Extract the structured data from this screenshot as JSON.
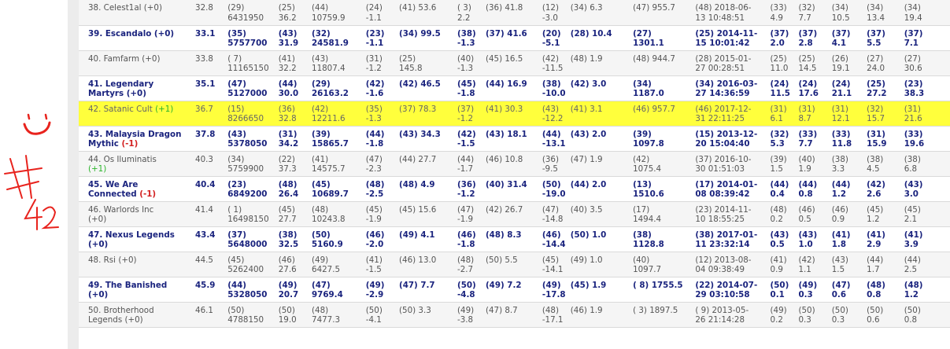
{
  "rows": [
    {
      "name": "38. Celest1al",
      "change": "(+0)",
      "change_type": "zero",
      "score": "32.8",
      "c1": "(29)\n6431950",
      "c2": "(25)\n36.2",
      "c3": "(44)\n10759.9",
      "c4": "(24)\n-1.1",
      "c5": "(41) 53.6",
      "c6": "( 3)\n2.2",
      "c7": "(36) 41.8",
      "c8": "(12)\n-3.0",
      "c9": "(34) 6.3",
      "c10": "(47) 955.7",
      "c11": "(48) 2018-06-\n13 10:48:51",
      "c12": "(33)\n4.9",
      "c13": "(32)\n7.7",
      "c14": "(34)\n10.5",
      "c15": "(34)\n13.4",
      "c16": "(34)\n19.4",
      "style": "alt"
    },
    {
      "name": "39. Escandalo",
      "change": "(+0)",
      "change_type": "zero",
      "score": "33.1",
      "c1": "(35)\n5757700",
      "c2": "(43)\n31.9",
      "c3": "(32)\n24581.9",
      "c4": "(23)\n-1.1",
      "c5": "(34) 99.5",
      "c6": "(38)\n-1.3",
      "c7": "(37) 41.6",
      "c8": "(20)\n-5.1",
      "c9": "(28) 10.4",
      "c10": "(27)\n1301.1",
      "c11": "(25) 2014-11-\n15 10:01:42",
      "c12": "(37)\n2.0",
      "c13": "(37)\n2.8",
      "c14": "(37)\n4.1",
      "c15": "(37)\n5.5",
      "c16": "(37)\n7.1",
      "style": "bold"
    },
    {
      "name": "40. Famfarm",
      "change": "(+0)",
      "change_type": "zero",
      "score": "33.8",
      "c1": "( 7)\n11165150",
      "c2": "(41)\n32.2",
      "c3": "(43)\n11807.4",
      "c4": "(31)\n-1.2",
      "c5": "(25)\n145.8",
      "c6": "(40)\n-1.3",
      "c7": "(45) 16.5",
      "c8": "(42)\n-11.5",
      "c9": "(48) 1.9",
      "c10": "(48) 944.7",
      "c11": "(28) 2015-01-\n27 00:28:51",
      "c12": "(25)\n11.0",
      "c13": "(25)\n14.5",
      "c14": "(26)\n19.1",
      "c15": "(27)\n24.0",
      "c16": "(27)\n30.6",
      "style": "alt"
    },
    {
      "name": "41. Legendary\nMartyrs",
      "change": "(+0)",
      "change_type": "zero",
      "score": "35.1",
      "c1": "(47)\n5127000",
      "c2": "(44)\n30.0",
      "c3": "(29)\n26163.2",
      "c4": "(42)\n-1.6",
      "c5": "(42) 46.5",
      "c6": "(45)\n-1.8",
      "c7": "(44) 16.9",
      "c8": "(38)\n-10.0",
      "c9": "(42) 3.0",
      "c10": "(34)\n1187.0",
      "c11": "(34) 2016-03-\n27 14:36:59",
      "c12": "(24)\n11.5",
      "c13": "(24)\n17.6",
      "c14": "(24)\n21.1",
      "c15": "(25)\n27.2",
      "c16": "(23)\n38.3",
      "style": "bold"
    },
    {
      "name": "42. Satanic Cult",
      "change": "(+1)",
      "change_type": "up",
      "score": "36.7",
      "c1": "(15)\n8266650",
      "c2": "(36)\n32.8",
      "c3": "(42)\n12211.6",
      "c4": "(35)\n-1.3",
      "c5": "(37) 78.3",
      "c6": "(37)\n-1.2",
      "c7": "(41) 30.3",
      "c8": "(43)\n-12.2",
      "c9": "(41) 3.1",
      "c10": "(46) 957.7",
      "c11": "(46) 2017-12-\n31 22:11:25",
      "c12": "(31)\n6.1",
      "c13": "(31)\n8.7",
      "c14": "(31)\n12.1",
      "c15": "(32)\n15.7",
      "c16": "(31)\n21.6",
      "style": "hl"
    },
    {
      "name": "43. Malaysia Dragon\nMythic",
      "change": "(-1)",
      "change_type": "down",
      "score": "37.8",
      "c1": "(43)\n5378050",
      "c2": "(31)\n34.2",
      "c3": "(39)\n15865.7",
      "c4": "(44)\n-1.8",
      "c5": "(43) 34.3",
      "c6": "(42)\n-1.5",
      "c7": "(43) 18.1",
      "c8": "(44)\n-13.1",
      "c9": "(43) 2.0",
      "c10": "(39)\n1097.8",
      "c11": "(15) 2013-12-\n20 15:04:40",
      "c12": "(32)\n5.3",
      "c13": "(33)\n7.7",
      "c14": "(33)\n11.8",
      "c15": "(31)\n15.9",
      "c16": "(33)\n19.6",
      "style": "bold"
    },
    {
      "name": "44. Os Iluminatis\n",
      "change": "(+1)",
      "change_type": "up",
      "score": "40.3",
      "c1": "(34)\n5759900",
      "c2": "(22)\n37.3",
      "c3": "(41)\n14575.7",
      "c4": "(47)\n-2.3",
      "c5": "(44) 27.7",
      "c6": "(44)\n-1.7",
      "c7": "(46) 10.8",
      "c8": "(36)\n-9.5",
      "c9": "(47) 1.9",
      "c10": "(42)\n1075.4",
      "c11": "(37) 2016-10-\n30 01:51:03",
      "c12": "(39)\n1.5",
      "c13": "(40)\n1.9",
      "c14": "(38)\n3.3",
      "c15": "(38)\n4.5",
      "c16": "(38)\n6.8",
      "style": "alt"
    },
    {
      "name": "45. We Are\nConnected",
      "change": "(-1)",
      "change_type": "down",
      "score": "40.4",
      "c1": "(23)\n6849200",
      "c2": "(48)\n26.4",
      "c3": "(45)\n10689.7",
      "c4": "(48)\n-2.5",
      "c5": "(48) 4.9",
      "c6": "(36)\n-1.2",
      "c7": "(40) 31.4",
      "c8": "(50)\n-19.0",
      "c9": "(44) 2.0",
      "c10": "(13)\n1510.6",
      "c11": "(17) 2014-01-\n08 08:39:42",
      "c12": "(44)\n0.4",
      "c13": "(44)\n0.8",
      "c14": "(44)\n1.2",
      "c15": "(42)\n2.6",
      "c16": "(43)\n3.0",
      "style": "bold"
    },
    {
      "name": "46. Warlords Inc\n",
      "change": "(+0)",
      "change_type": "zero",
      "score": "41.4",
      "c1": "( 1)\n16498150",
      "c2": "(45)\n27.7",
      "c3": "(48)\n10243.8",
      "c4": "(45)\n-1.9",
      "c5": "(45) 15.6",
      "c6": "(47)\n-1.9",
      "c7": "(42) 26.7",
      "c8": "(47)\n-14.8",
      "c9": "(40) 3.5",
      "c10": "(17)\n1494.4",
      "c11": "(23) 2014-11-\n10 18:55:25",
      "c12": "(48)\n0.2",
      "c13": "(46)\n0.5",
      "c14": "(46)\n0.9",
      "c15": "(45)\n1.2",
      "c16": "(45)\n2.1",
      "style": "alt"
    },
    {
      "name": "47. Nexus Legends\n",
      "change": "(+0)",
      "change_type": "zero",
      "score": "43.4",
      "c1": "(37)\n5648000",
      "c2": "(38)\n32.5",
      "c3": "(50)\n5160.9",
      "c4": "(46)\n-2.0",
      "c5": "(49) 4.1",
      "c6": "(46)\n-1.8",
      "c7": "(48) 8.3",
      "c8": "(46)\n-14.4",
      "c9": "(50) 1.0",
      "c10": "(38)\n1128.8",
      "c11": "(38) 2017-01-\n11 23:32:14",
      "c12": "(43)\n0.5",
      "c13": "(43)\n1.0",
      "c14": "(41)\n1.8",
      "c15": "(41)\n2.9",
      "c16": "(41)\n3.9",
      "style": "bold"
    },
    {
      "name": "48. Rsi",
      "change": "(+0)",
      "change_type": "zero",
      "score": "44.5",
      "c1": "(45)\n5262400",
      "c2": "(46)\n27.6",
      "c3": "(49)\n6427.5",
      "c4": "(41)\n-1.5",
      "c5": "(46) 13.0",
      "c6": "(48)\n-2.7",
      "c7": "(50) 5.5",
      "c8": "(45)\n-14.1",
      "c9": "(49) 1.0",
      "c10": "(40)\n1097.7",
      "c11": "(12) 2013-08-\n04 09:38:49",
      "c12": "(41)\n0.9",
      "c13": "(42)\n1.1",
      "c14": "(43)\n1.5",
      "c15": "(44)\n1.7",
      "c16": "(44)\n2.5",
      "style": "alt"
    },
    {
      "name": "49. The Banished\n",
      "change": "(+0)",
      "change_type": "zero",
      "score": "45.9",
      "c1": "(44)\n5328050",
      "c2": "(49)\n20.7",
      "c3": "(47)\n9769.4",
      "c4": "(49)\n-2.9",
      "c5": "(47) 7.7",
      "c6": "(50)\n-4.8",
      "c7": "(49) 7.2",
      "c8": "(49)\n-17.8",
      "c9": "(45) 1.9",
      "c10": "( 8) 1755.5",
      "c11": "(22) 2014-07-\n29 03:10:58",
      "c12": "(50)\n0.1",
      "c13": "(49)\n0.3",
      "c14": "(47)\n0.6",
      "c15": "(48)\n0.8",
      "c16": "(48)\n1.2",
      "style": "bold"
    },
    {
      "name": "50. Brotherhood\nLegends",
      "change": "(+0)",
      "change_type": "zero",
      "score": "46.1",
      "c1": "(50)\n4788150",
      "c2": "(50)\n19.0",
      "c3": "(48)\n7477.3",
      "c4": "(50)\n-4.1",
      "c5": "(50) 3.3",
      "c6": "(49)\n-3.8",
      "c7": "(47) 8.7",
      "c8": "(48)\n-17.1",
      "c9": "(46) 1.9",
      "c10": "( 3) 1897.5",
      "c11": "( 9) 2013-05-\n26 21:14:28",
      "c12": "(49)\n0.2",
      "c13": "(50)\n0.3",
      "c14": "(50)\n0.3",
      "c15": "(50)\n0.6",
      "c16": "(50)\n0.8",
      "style": "alt"
    }
  ],
  "colors": {
    "highlight": "#ffff3c",
    "bold_text": "#1a237e",
    "up": "#2bb52b",
    "down": "#d32020",
    "annotation": "#e8231d"
  }
}
